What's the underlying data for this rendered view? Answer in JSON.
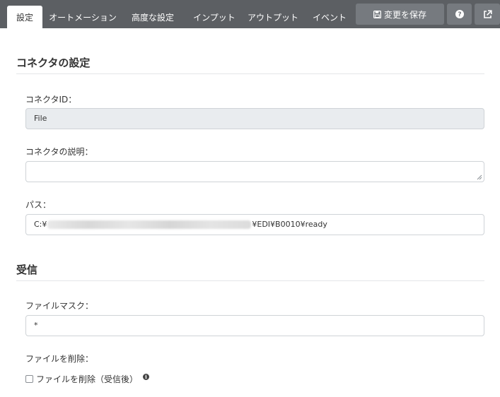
{
  "tabs": [
    {
      "label": "設定",
      "active": true
    },
    {
      "label": "オートメーション",
      "active": false
    },
    {
      "label": "高度な設定",
      "active": false
    },
    {
      "label": "インプット",
      "active": false
    },
    {
      "label": "アウトプット",
      "active": false
    },
    {
      "label": "イベント",
      "active": false
    }
  ],
  "toolbar": {
    "save_label": "変更を保存",
    "save_icon": "floppy-disk-icon",
    "help_icon": "question-circle-icon",
    "popout_icon": "external-link-icon"
  },
  "connector_section": {
    "title": "コネクタの設定",
    "id_label": "コネクタID：",
    "id_value": "File",
    "description_label": "コネクタの説明：",
    "description_value": "",
    "path_label": "パス：",
    "path_value_prefix": "C:¥",
    "path_value_suffix": "¥EDI¥B0010¥ready"
  },
  "receive_section": {
    "title": "受信",
    "file_mask_label": "ファイルマスク：",
    "file_mask_value": "*",
    "delete_label": "ファイルを削除：",
    "delete_checkbox_label": "ファイルを削除（受信後）",
    "delete_checked": false,
    "info_icon": "info-circle-icon"
  },
  "colors": {
    "topbar": "#5c5f63",
    "button": "#767a7f",
    "readonly_field": "#e9ecef"
  }
}
